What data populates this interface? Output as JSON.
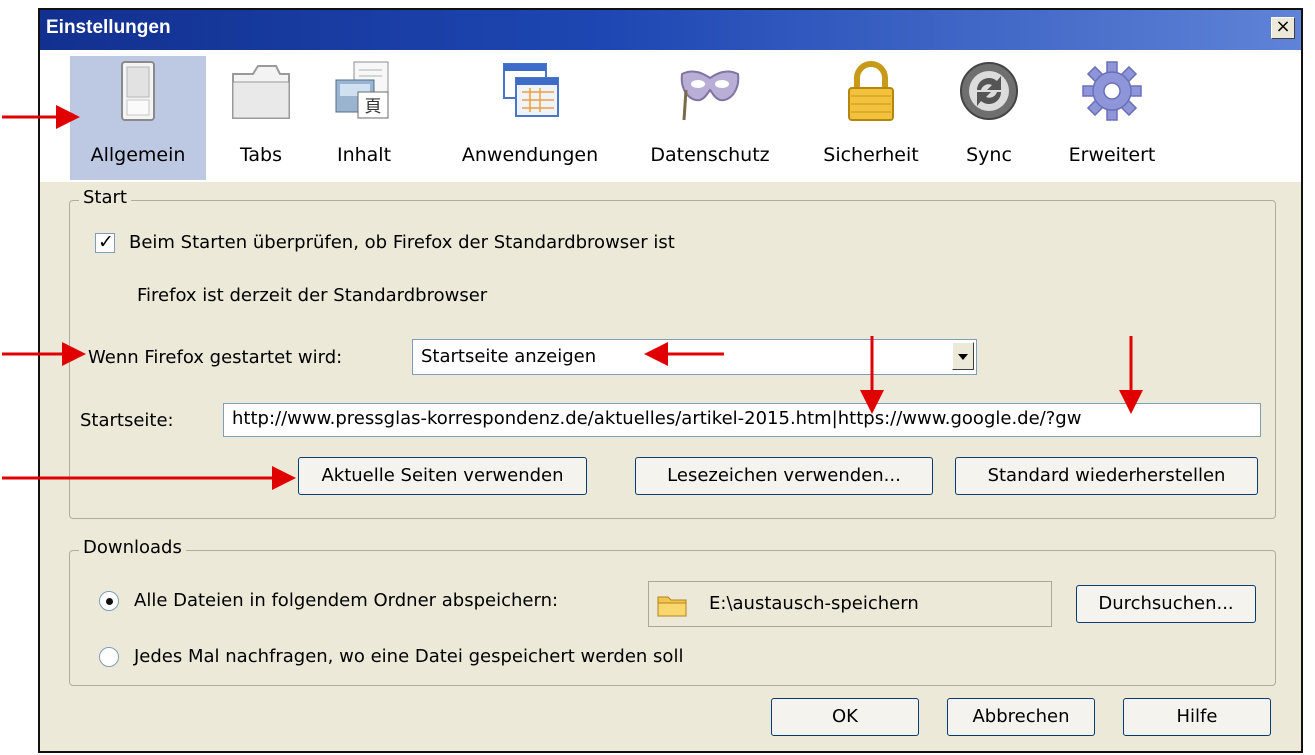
{
  "window": {
    "title": "Einstellungen",
    "close_label": "×"
  },
  "toolbar": [
    {
      "label": "Allgemein",
      "icon": "general-switch-icon",
      "selected": true
    },
    {
      "label": "Tabs",
      "icon": "tabs-icon"
    },
    {
      "label": "Inhalt",
      "icon": "content-icon"
    },
    {
      "label": "Anwendungen",
      "icon": "applications-icon"
    },
    {
      "label": "Datenschutz",
      "icon": "privacy-mask-icon"
    },
    {
      "label": "Sicherheit",
      "icon": "padlock-icon"
    },
    {
      "label": "Sync",
      "icon": "sync-icon"
    },
    {
      "label": "Erweitert",
      "icon": "gear-icon"
    }
  ],
  "start": {
    "legend": "Start",
    "check_default_label": "Beim Starten überprüfen, ob Firefox der Standardbrowser ist",
    "check_default_checked": true,
    "default_status": "Firefox ist derzeit der Standardbrowser",
    "when_started_label": "Wenn Firefox gestartet wird:",
    "when_started_value": "Startseite anzeigen",
    "homepage_label": "Startseite:",
    "homepage_value": "http://www.pressglas-korrespondenz.de/aktuelles/artikel-2015.htm|https://www.google.de/?gw",
    "btn_current": "Aktuelle Seiten verwenden",
    "btn_bookmark": "Lesezeichen verwenden...",
    "btn_restore": "Standard wiederherstellen"
  },
  "downloads": {
    "legend": "Downloads",
    "save_to_label": "Alle Dateien in folgendem Ordner abspeichern:",
    "save_to_selected": true,
    "folder": "E:\\austausch-speichern",
    "btn_browse": "Durchsuchen...",
    "ask_label": "Jedes Mal nachfragen, wo eine Datei gespeichert werden soll"
  },
  "footer": {
    "ok": "OK",
    "cancel": "Abbrechen",
    "help": "Hilfe"
  },
  "colors": {
    "annotation_arrow": "#e00000",
    "titlebar": "#1e47b3",
    "dialog_bg": "#ece9d8"
  }
}
